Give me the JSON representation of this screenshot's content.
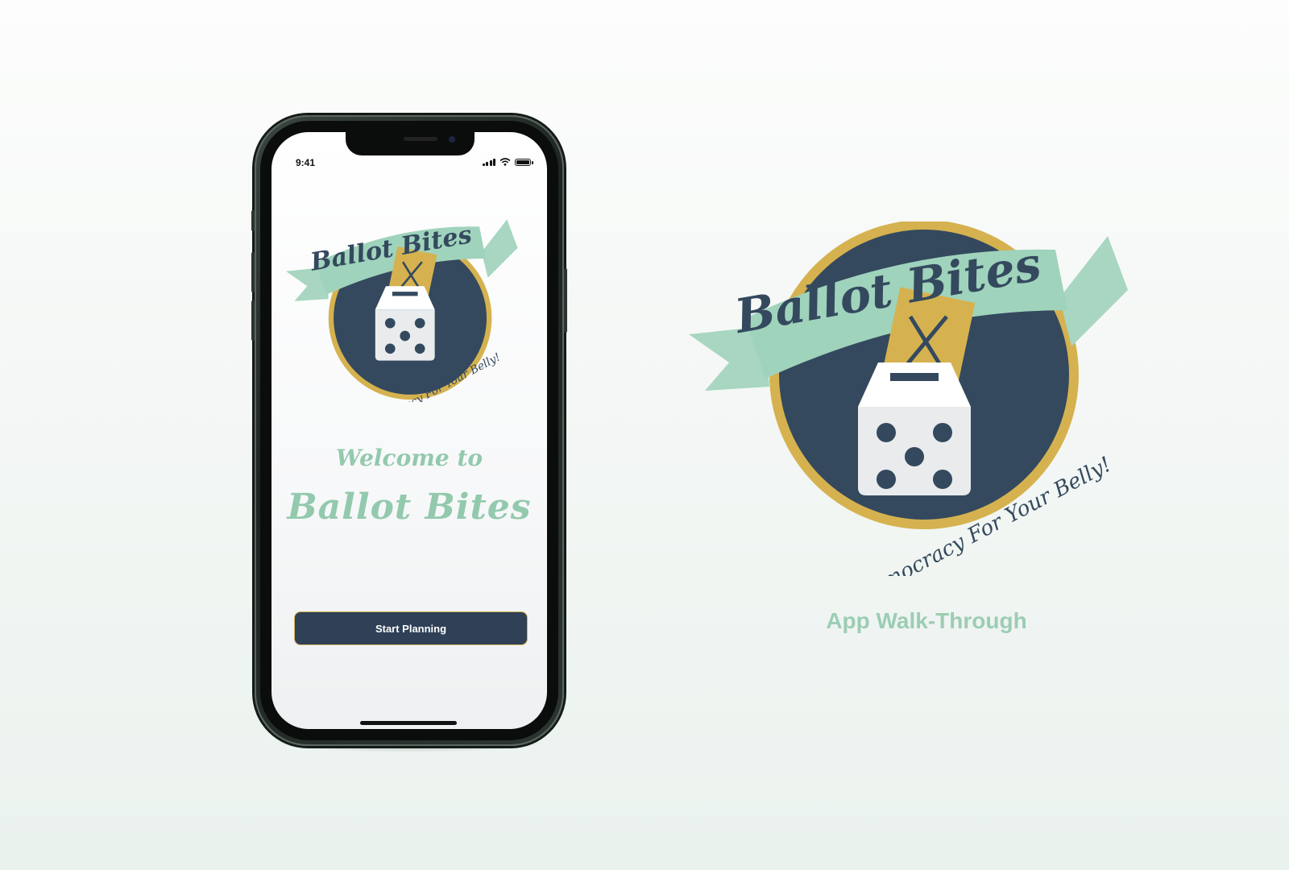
{
  "status_bar": {
    "time": "9:41"
  },
  "logo": {
    "brand": "Ballot Bites",
    "tagline": "Democracy For Your Belly!"
  },
  "welcome": {
    "line1": "Welcome to",
    "line2": "Ballot Bites"
  },
  "start_button": {
    "label": "Start Planning"
  },
  "caption": {
    "text": "App Walk-Through"
  },
  "colors": {
    "navy": "#34495e",
    "mint": "#9ccfb8",
    "gold": "#d5b24f",
    "button": "#2f4057",
    "welcome_text": "#93c9ad"
  },
  "icons": [
    "ballot-box-icon",
    "fork-knife-icon",
    "dice-icon"
  ]
}
